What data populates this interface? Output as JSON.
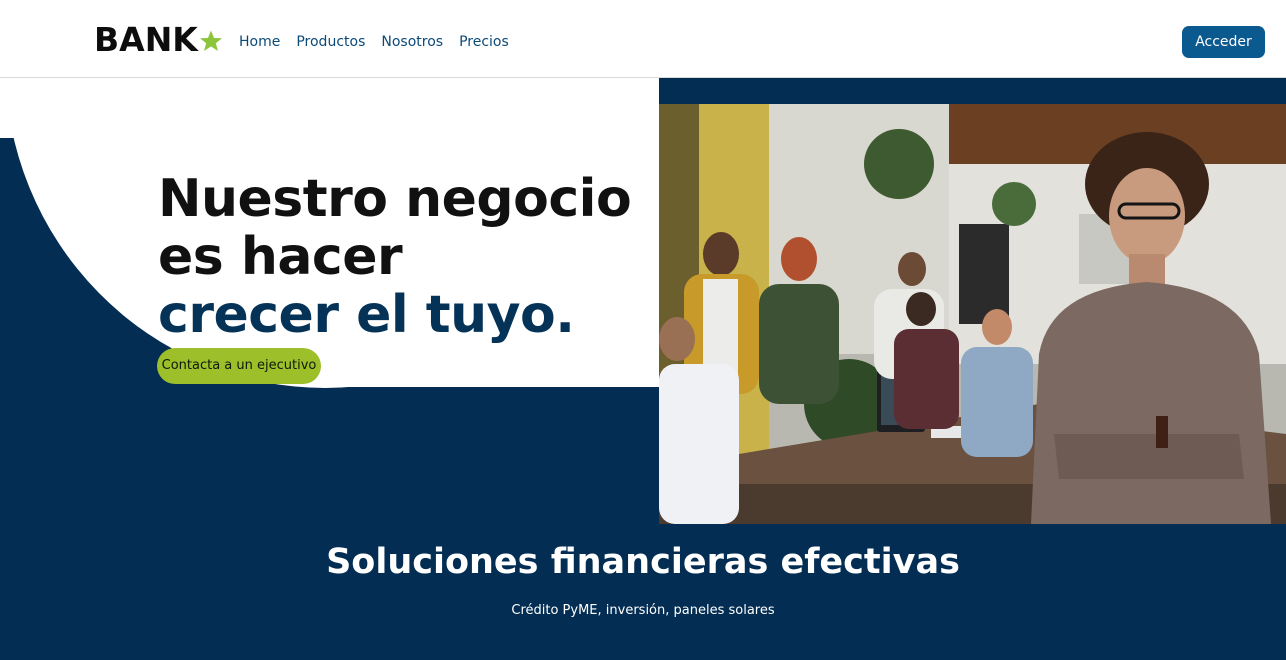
{
  "header": {
    "logo_text": "BANK",
    "logo_icon": "star-icon",
    "nav": [
      {
        "label": "Home"
      },
      {
        "label": "Productos"
      },
      {
        "label": "Nosotros"
      },
      {
        "label": "Precios"
      }
    ],
    "login_label": "Acceder"
  },
  "hero": {
    "headline_line1": "Nuestro negocio",
    "headline_line2": "es hacer",
    "headline_line3": "crecer el tuyo.",
    "cta_label": "Contacta a un ejecutivo"
  },
  "section": {
    "title": "Soluciones financieras efectivas",
    "subtitle": "Crédito PyME, inversión, paneles solares"
  },
  "colors": {
    "navy": "#032d52",
    "brand_blue": "#0b5a8f",
    "accent_green": "#9cbf2a",
    "star_green": "#8cc43a"
  }
}
